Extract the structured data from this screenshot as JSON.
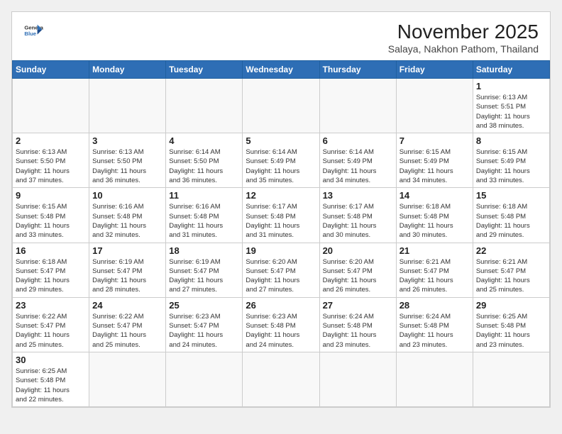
{
  "header": {
    "logo_general": "General",
    "logo_blue": "Blue",
    "month_title": "November 2025",
    "subtitle": "Salaya, Nakhon Pathom, Thailand"
  },
  "days_of_week": [
    "Sunday",
    "Monday",
    "Tuesday",
    "Wednesday",
    "Thursday",
    "Friday",
    "Saturday"
  ],
  "weeks": [
    [
      {
        "day": "",
        "info": ""
      },
      {
        "day": "",
        "info": ""
      },
      {
        "day": "",
        "info": ""
      },
      {
        "day": "",
        "info": ""
      },
      {
        "day": "",
        "info": ""
      },
      {
        "day": "",
        "info": ""
      },
      {
        "day": "1",
        "info": "Sunrise: 6:13 AM\nSunset: 5:51 PM\nDaylight: 11 hours\nand 38 minutes."
      }
    ],
    [
      {
        "day": "2",
        "info": "Sunrise: 6:13 AM\nSunset: 5:50 PM\nDaylight: 11 hours\nand 37 minutes."
      },
      {
        "day": "3",
        "info": "Sunrise: 6:13 AM\nSunset: 5:50 PM\nDaylight: 11 hours\nand 36 minutes."
      },
      {
        "day": "4",
        "info": "Sunrise: 6:14 AM\nSunset: 5:50 PM\nDaylight: 11 hours\nand 36 minutes."
      },
      {
        "day": "5",
        "info": "Sunrise: 6:14 AM\nSunset: 5:49 PM\nDaylight: 11 hours\nand 35 minutes."
      },
      {
        "day": "6",
        "info": "Sunrise: 6:14 AM\nSunset: 5:49 PM\nDaylight: 11 hours\nand 34 minutes."
      },
      {
        "day": "7",
        "info": "Sunrise: 6:15 AM\nSunset: 5:49 PM\nDaylight: 11 hours\nand 34 minutes."
      },
      {
        "day": "8",
        "info": "Sunrise: 6:15 AM\nSunset: 5:49 PM\nDaylight: 11 hours\nand 33 minutes."
      }
    ],
    [
      {
        "day": "9",
        "info": "Sunrise: 6:15 AM\nSunset: 5:48 PM\nDaylight: 11 hours\nand 33 minutes."
      },
      {
        "day": "10",
        "info": "Sunrise: 6:16 AM\nSunset: 5:48 PM\nDaylight: 11 hours\nand 32 minutes."
      },
      {
        "day": "11",
        "info": "Sunrise: 6:16 AM\nSunset: 5:48 PM\nDaylight: 11 hours\nand 31 minutes."
      },
      {
        "day": "12",
        "info": "Sunrise: 6:17 AM\nSunset: 5:48 PM\nDaylight: 11 hours\nand 31 minutes."
      },
      {
        "day": "13",
        "info": "Sunrise: 6:17 AM\nSunset: 5:48 PM\nDaylight: 11 hours\nand 30 minutes."
      },
      {
        "day": "14",
        "info": "Sunrise: 6:18 AM\nSunset: 5:48 PM\nDaylight: 11 hours\nand 30 minutes."
      },
      {
        "day": "15",
        "info": "Sunrise: 6:18 AM\nSunset: 5:48 PM\nDaylight: 11 hours\nand 29 minutes."
      }
    ],
    [
      {
        "day": "16",
        "info": "Sunrise: 6:18 AM\nSunset: 5:47 PM\nDaylight: 11 hours\nand 29 minutes."
      },
      {
        "day": "17",
        "info": "Sunrise: 6:19 AM\nSunset: 5:47 PM\nDaylight: 11 hours\nand 28 minutes."
      },
      {
        "day": "18",
        "info": "Sunrise: 6:19 AM\nSunset: 5:47 PM\nDaylight: 11 hours\nand 27 minutes."
      },
      {
        "day": "19",
        "info": "Sunrise: 6:20 AM\nSunset: 5:47 PM\nDaylight: 11 hours\nand 27 minutes."
      },
      {
        "day": "20",
        "info": "Sunrise: 6:20 AM\nSunset: 5:47 PM\nDaylight: 11 hours\nand 26 minutes."
      },
      {
        "day": "21",
        "info": "Sunrise: 6:21 AM\nSunset: 5:47 PM\nDaylight: 11 hours\nand 26 minutes."
      },
      {
        "day": "22",
        "info": "Sunrise: 6:21 AM\nSunset: 5:47 PM\nDaylight: 11 hours\nand 25 minutes."
      }
    ],
    [
      {
        "day": "23",
        "info": "Sunrise: 6:22 AM\nSunset: 5:47 PM\nDaylight: 11 hours\nand 25 minutes."
      },
      {
        "day": "24",
        "info": "Sunrise: 6:22 AM\nSunset: 5:47 PM\nDaylight: 11 hours\nand 25 minutes."
      },
      {
        "day": "25",
        "info": "Sunrise: 6:23 AM\nSunset: 5:47 PM\nDaylight: 11 hours\nand 24 minutes."
      },
      {
        "day": "26",
        "info": "Sunrise: 6:23 AM\nSunset: 5:48 PM\nDaylight: 11 hours\nand 24 minutes."
      },
      {
        "day": "27",
        "info": "Sunrise: 6:24 AM\nSunset: 5:48 PM\nDaylight: 11 hours\nand 23 minutes."
      },
      {
        "day": "28",
        "info": "Sunrise: 6:24 AM\nSunset: 5:48 PM\nDaylight: 11 hours\nand 23 minutes."
      },
      {
        "day": "29",
        "info": "Sunrise: 6:25 AM\nSunset: 5:48 PM\nDaylight: 11 hours\nand 23 minutes."
      }
    ],
    [
      {
        "day": "30",
        "info": "Sunrise: 6:25 AM\nSunset: 5:48 PM\nDaylight: 11 hours\nand 22 minutes."
      },
      {
        "day": "",
        "info": ""
      },
      {
        "day": "",
        "info": ""
      },
      {
        "day": "",
        "info": ""
      },
      {
        "day": "",
        "info": ""
      },
      {
        "day": "",
        "info": ""
      },
      {
        "day": "",
        "info": ""
      }
    ]
  ]
}
